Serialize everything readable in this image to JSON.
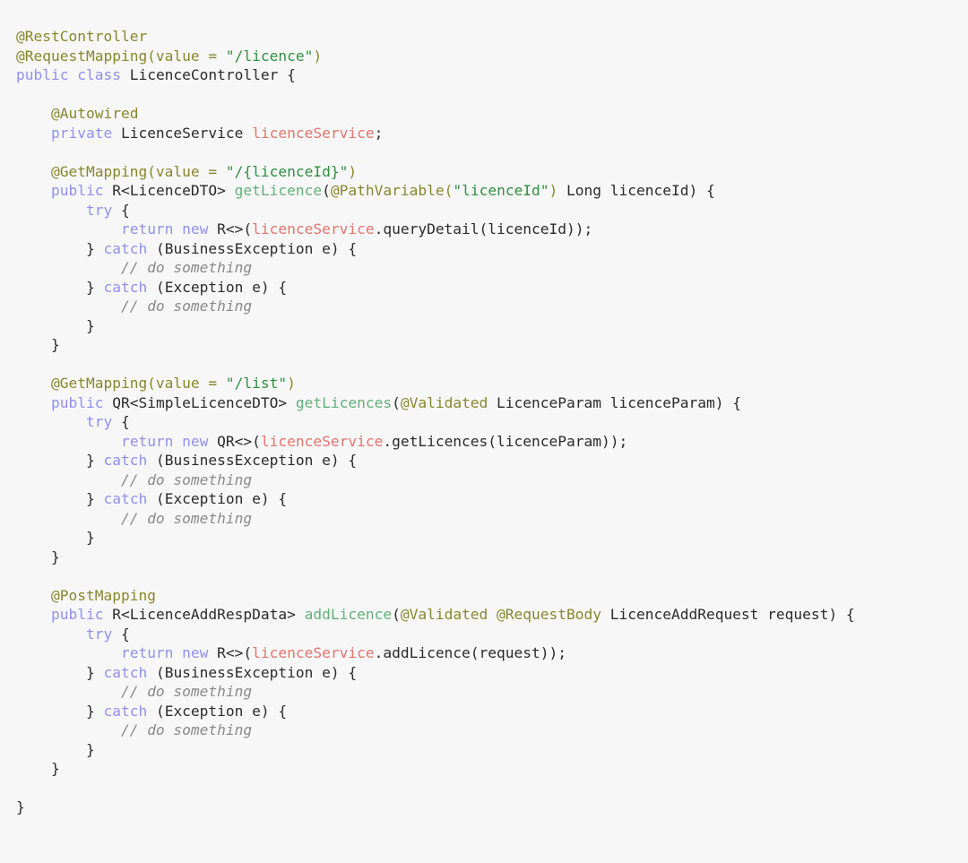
{
  "editor": {
    "language": "java",
    "filename": "LicenceController.java",
    "background_color": "#f7f7f7",
    "theme": "light"
  },
  "palette": {
    "plain": "#2b2b2b",
    "keyword": "#9090ee",
    "annotation": "#87872d",
    "string": "#2f8f3f",
    "method": "#62b07a",
    "field": "#e4746e",
    "comment": "#8a8a8a"
  },
  "code": {
    "lines": [
      {
        "n": 1,
        "tokens": [
          {
            "t": "anno",
            "v": "@RestController"
          }
        ]
      },
      {
        "n": 2,
        "tokens": [
          {
            "t": "anno",
            "v": "@RequestMapping(value = "
          },
          {
            "t": "str",
            "v": "\"/licence\""
          },
          {
            "t": "anno",
            "v": ")"
          }
        ]
      },
      {
        "n": 3,
        "tokens": [
          {
            "t": "kw",
            "v": "public class "
          },
          {
            "t": "plain",
            "v": "LicenceController {"
          }
        ]
      },
      {
        "n": 4,
        "tokens": []
      },
      {
        "n": 5,
        "tokens": [
          {
            "t": "plain",
            "v": "    "
          },
          {
            "t": "anno",
            "v": "@Autowired"
          }
        ]
      },
      {
        "n": 6,
        "tokens": [
          {
            "t": "plain",
            "v": "    "
          },
          {
            "t": "kw",
            "v": "private "
          },
          {
            "t": "plain",
            "v": "LicenceService "
          },
          {
            "t": "field",
            "v": "licenceService"
          },
          {
            "t": "plain",
            "v": ";"
          }
        ]
      },
      {
        "n": 7,
        "tokens": []
      },
      {
        "n": 8,
        "tokens": [
          {
            "t": "plain",
            "v": "    "
          },
          {
            "t": "anno",
            "v": "@GetMapping(value = "
          },
          {
            "t": "str",
            "v": "\"/{licenceId}\""
          },
          {
            "t": "anno",
            "v": ")"
          }
        ]
      },
      {
        "n": 9,
        "tokens": [
          {
            "t": "plain",
            "v": "    "
          },
          {
            "t": "kw",
            "v": "public "
          },
          {
            "t": "plain",
            "v": "R<LicenceDTO> "
          },
          {
            "t": "method",
            "v": "getLicence"
          },
          {
            "t": "plain",
            "v": "("
          },
          {
            "t": "anno",
            "v": "@PathVariable("
          },
          {
            "t": "str",
            "v": "\"licenceId\""
          },
          {
            "t": "anno",
            "v": ")"
          },
          {
            "t": "plain",
            "v": " Long licenceId) {"
          }
        ]
      },
      {
        "n": 10,
        "tokens": [
          {
            "t": "plain",
            "v": "        "
          },
          {
            "t": "kw",
            "v": "try"
          },
          {
            "t": "plain",
            "v": " {"
          }
        ]
      },
      {
        "n": 11,
        "tokens": [
          {
            "t": "plain",
            "v": "            "
          },
          {
            "t": "kw",
            "v": "return new "
          },
          {
            "t": "plain",
            "v": "R<>("
          },
          {
            "t": "field",
            "v": "licenceService"
          },
          {
            "t": "plain",
            "v": ".queryDetail(licenceId));"
          }
        ]
      },
      {
        "n": 12,
        "tokens": [
          {
            "t": "plain",
            "v": "        } "
          },
          {
            "t": "kw",
            "v": "catch"
          },
          {
            "t": "plain",
            "v": " (BusinessException e) {"
          }
        ]
      },
      {
        "n": 13,
        "tokens": [
          {
            "t": "plain",
            "v": "            "
          },
          {
            "t": "cmt",
            "v": "// do something"
          }
        ]
      },
      {
        "n": 14,
        "tokens": [
          {
            "t": "plain",
            "v": "        } "
          },
          {
            "t": "kw",
            "v": "catch"
          },
          {
            "t": "plain",
            "v": " (Exception e) {"
          }
        ]
      },
      {
        "n": 15,
        "tokens": [
          {
            "t": "plain",
            "v": "            "
          },
          {
            "t": "cmt",
            "v": "// do something"
          }
        ]
      },
      {
        "n": 16,
        "tokens": [
          {
            "t": "plain",
            "v": "        }"
          }
        ]
      },
      {
        "n": 17,
        "tokens": [
          {
            "t": "plain",
            "v": "    }"
          }
        ]
      },
      {
        "n": 18,
        "tokens": []
      },
      {
        "n": 19,
        "tokens": [
          {
            "t": "plain",
            "v": "    "
          },
          {
            "t": "anno",
            "v": "@GetMapping(value = "
          },
          {
            "t": "str",
            "v": "\"/list\""
          },
          {
            "t": "anno",
            "v": ")"
          }
        ]
      },
      {
        "n": 20,
        "tokens": [
          {
            "t": "plain",
            "v": "    "
          },
          {
            "t": "kw",
            "v": "public "
          },
          {
            "t": "plain",
            "v": "QR<SimpleLicenceDTO> "
          },
          {
            "t": "method",
            "v": "getLicences"
          },
          {
            "t": "plain",
            "v": "("
          },
          {
            "t": "anno",
            "v": "@Validated"
          },
          {
            "t": "plain",
            "v": " LicenceParam licenceParam) {"
          }
        ]
      },
      {
        "n": 21,
        "tokens": [
          {
            "t": "plain",
            "v": "        "
          },
          {
            "t": "kw",
            "v": "try"
          },
          {
            "t": "plain",
            "v": " {"
          }
        ]
      },
      {
        "n": 22,
        "tokens": [
          {
            "t": "plain",
            "v": "            "
          },
          {
            "t": "kw",
            "v": "return new "
          },
          {
            "t": "plain",
            "v": "QR<>("
          },
          {
            "t": "field",
            "v": "licenceService"
          },
          {
            "t": "plain",
            "v": ".getLicences(licenceParam));"
          }
        ]
      },
      {
        "n": 23,
        "tokens": [
          {
            "t": "plain",
            "v": "        } "
          },
          {
            "t": "kw",
            "v": "catch"
          },
          {
            "t": "plain",
            "v": " (BusinessException e) {"
          }
        ]
      },
      {
        "n": 24,
        "tokens": [
          {
            "t": "plain",
            "v": "            "
          },
          {
            "t": "cmt",
            "v": "// do something"
          }
        ]
      },
      {
        "n": 25,
        "tokens": [
          {
            "t": "plain",
            "v": "        } "
          },
          {
            "t": "kw",
            "v": "catch"
          },
          {
            "t": "plain",
            "v": " (Exception e) {"
          }
        ]
      },
      {
        "n": 26,
        "tokens": [
          {
            "t": "plain",
            "v": "            "
          },
          {
            "t": "cmt",
            "v": "// do something"
          }
        ]
      },
      {
        "n": 27,
        "tokens": [
          {
            "t": "plain",
            "v": "        }"
          }
        ]
      },
      {
        "n": 28,
        "tokens": [
          {
            "t": "plain",
            "v": "    }"
          }
        ]
      },
      {
        "n": 29,
        "tokens": []
      },
      {
        "n": 30,
        "tokens": [
          {
            "t": "plain",
            "v": "    "
          },
          {
            "t": "anno",
            "v": "@PostMapping"
          }
        ]
      },
      {
        "n": 31,
        "tokens": [
          {
            "t": "plain",
            "v": "    "
          },
          {
            "t": "kw",
            "v": "public "
          },
          {
            "t": "plain",
            "v": "R<LicenceAddRespData> "
          },
          {
            "t": "method",
            "v": "addLicence"
          },
          {
            "t": "plain",
            "v": "("
          },
          {
            "t": "anno",
            "v": "@Validated @RequestBody"
          },
          {
            "t": "plain",
            "v": " LicenceAddRequest request) {"
          }
        ]
      },
      {
        "n": 32,
        "tokens": [
          {
            "t": "plain",
            "v": "        "
          },
          {
            "t": "kw",
            "v": "try"
          },
          {
            "t": "plain",
            "v": " {"
          }
        ]
      },
      {
        "n": 33,
        "tokens": [
          {
            "t": "plain",
            "v": "            "
          },
          {
            "t": "kw",
            "v": "return new "
          },
          {
            "t": "plain",
            "v": "R<>("
          },
          {
            "t": "field",
            "v": "licenceService"
          },
          {
            "t": "plain",
            "v": ".addLicence(request));"
          }
        ]
      },
      {
        "n": 34,
        "tokens": [
          {
            "t": "plain",
            "v": "        } "
          },
          {
            "t": "kw",
            "v": "catch"
          },
          {
            "t": "plain",
            "v": " (BusinessException e) {"
          }
        ]
      },
      {
        "n": 35,
        "tokens": [
          {
            "t": "plain",
            "v": "            "
          },
          {
            "t": "cmt",
            "v": "// do something"
          }
        ]
      },
      {
        "n": 36,
        "tokens": [
          {
            "t": "plain",
            "v": "        } "
          },
          {
            "t": "kw",
            "v": "catch"
          },
          {
            "t": "plain",
            "v": " (Exception e) {"
          }
        ]
      },
      {
        "n": 37,
        "tokens": [
          {
            "t": "plain",
            "v": "            "
          },
          {
            "t": "cmt",
            "v": "// do something"
          }
        ]
      },
      {
        "n": 38,
        "tokens": [
          {
            "t": "plain",
            "v": "        }"
          }
        ]
      },
      {
        "n": 39,
        "tokens": [
          {
            "t": "plain",
            "v": "    }"
          }
        ]
      },
      {
        "n": 40,
        "tokens": []
      },
      {
        "n": 41,
        "tokens": [
          {
            "t": "plain",
            "v": "}"
          }
        ]
      }
    ]
  }
}
